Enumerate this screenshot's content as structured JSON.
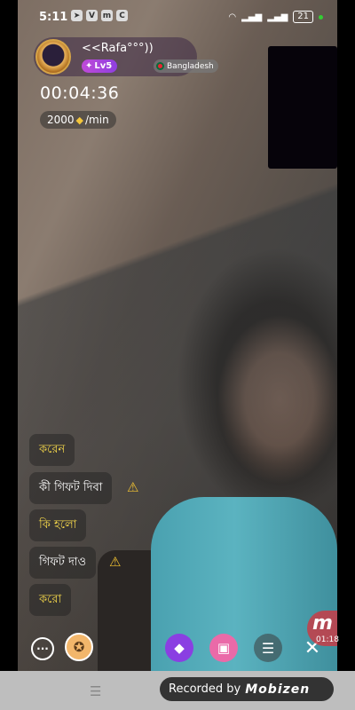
{
  "status_bar": {
    "time": "5:11",
    "notif_icons": [
      "telegram-icon",
      "v-icon",
      "m-icon",
      "c-icon"
    ],
    "battery": "21"
  },
  "host": {
    "name": "<<Rafa°°°))",
    "level": "Lv5",
    "country": "Bangladesh"
  },
  "call": {
    "timer": "00:04:36",
    "rate_amount": "2000",
    "rate_unit": "/min"
  },
  "messages": [
    {
      "text": "করেন",
      "color": "yellow",
      "warning": false
    },
    {
      "text": "কী গিফট দিবা",
      "color": "white",
      "warning": true
    },
    {
      "text": "কি হলো",
      "color": "yellow",
      "warning": false
    },
    {
      "text": "গিফট দাও",
      "color": "white",
      "warning": true
    },
    {
      "text": "করো",
      "color": "yellow",
      "warning": false
    }
  ],
  "recorder": {
    "bubble_letter": "m",
    "elapsed": "01:18",
    "label": "Recorded by",
    "brand": "Mobizen"
  },
  "colors": {
    "accent_purple": "#8a3fe2",
    "gift_pink": "#ea6aa8",
    "message_yellow": "#f3d64a"
  }
}
